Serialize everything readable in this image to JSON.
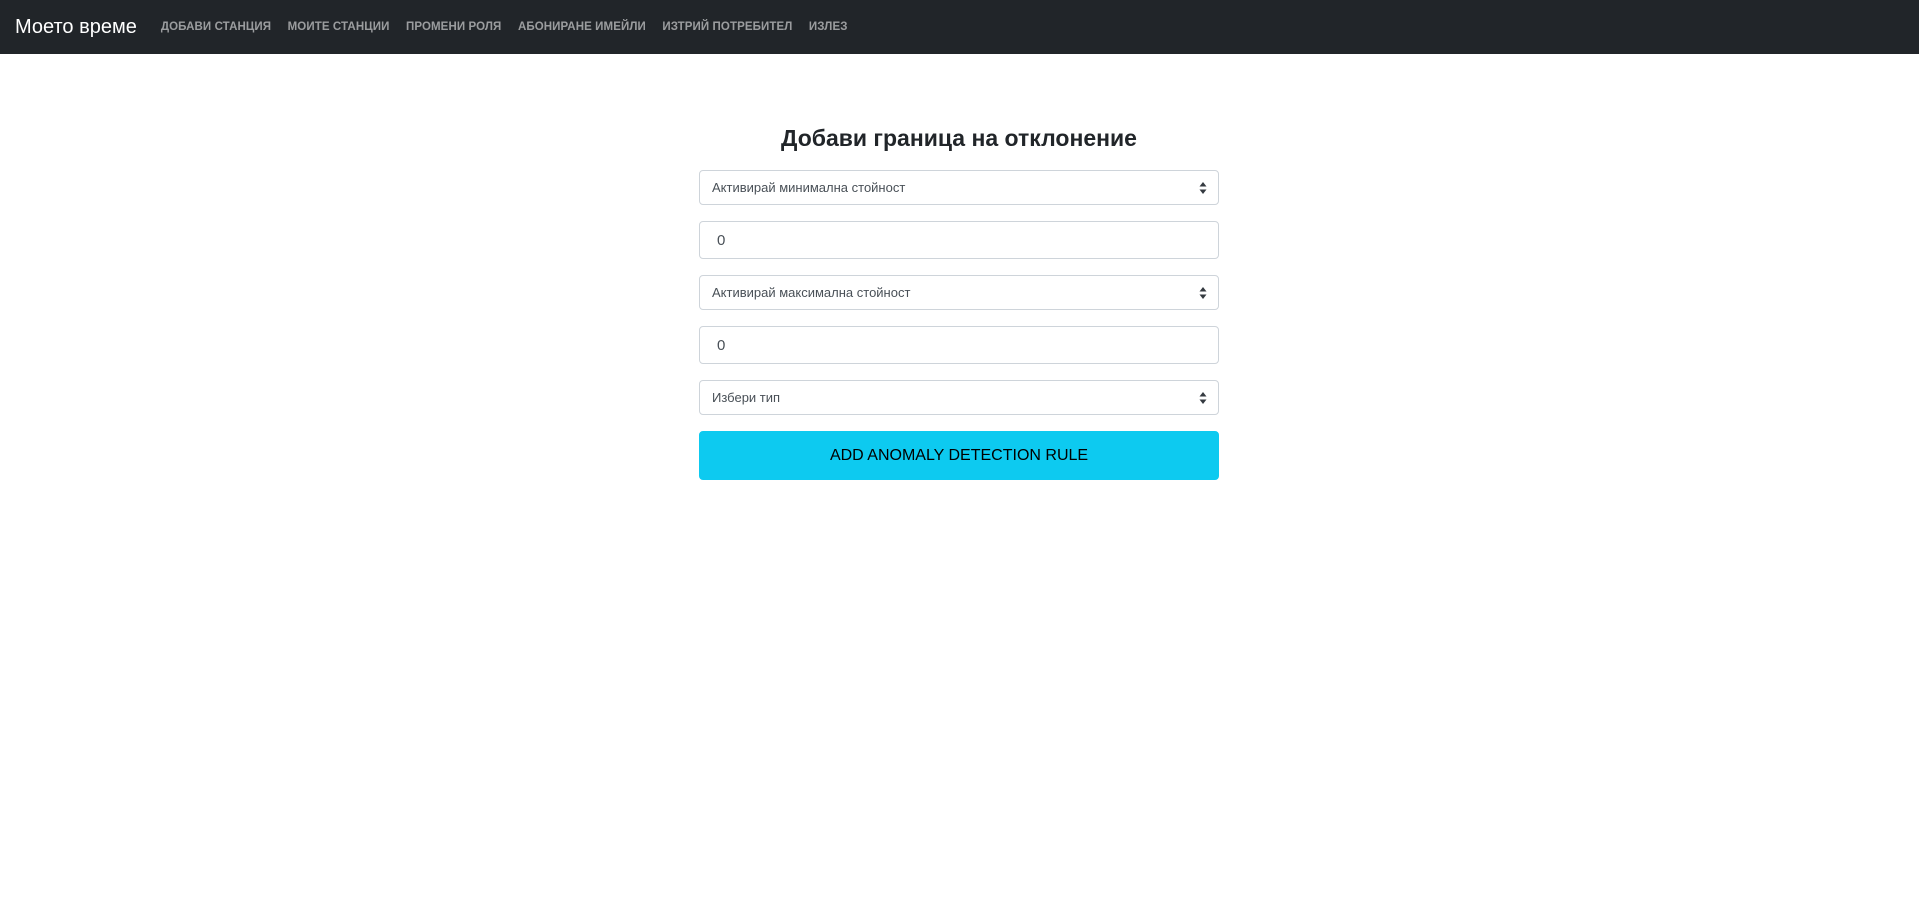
{
  "navbar": {
    "brand": "Моето време",
    "links": [
      "ДОБАВИ СТАНЦИЯ",
      "МОИТЕ СТАНЦИИ",
      "ПРОМЕНИ РОЛЯ",
      "АБОНИРАНЕ ИМЕЙЛИ",
      "ИЗТРИЙ ПОТРЕБИТЕЛ",
      "ИЗЛЕЗ"
    ]
  },
  "form": {
    "title": "Добави граница на отклонение",
    "min_select": "Активирай минимална стойност",
    "min_value": "0",
    "max_select": "Активирай максимална стойност",
    "max_value": "0",
    "type_select": "Избери тип",
    "submit_label": "ADD ANOMALY DETECTION RULE"
  },
  "colors": {
    "navbar_bg": "#212529",
    "button_bg": "#0dcaf0"
  },
  "icons": {
    "select_arrows": "sort-arrows-icon"
  }
}
